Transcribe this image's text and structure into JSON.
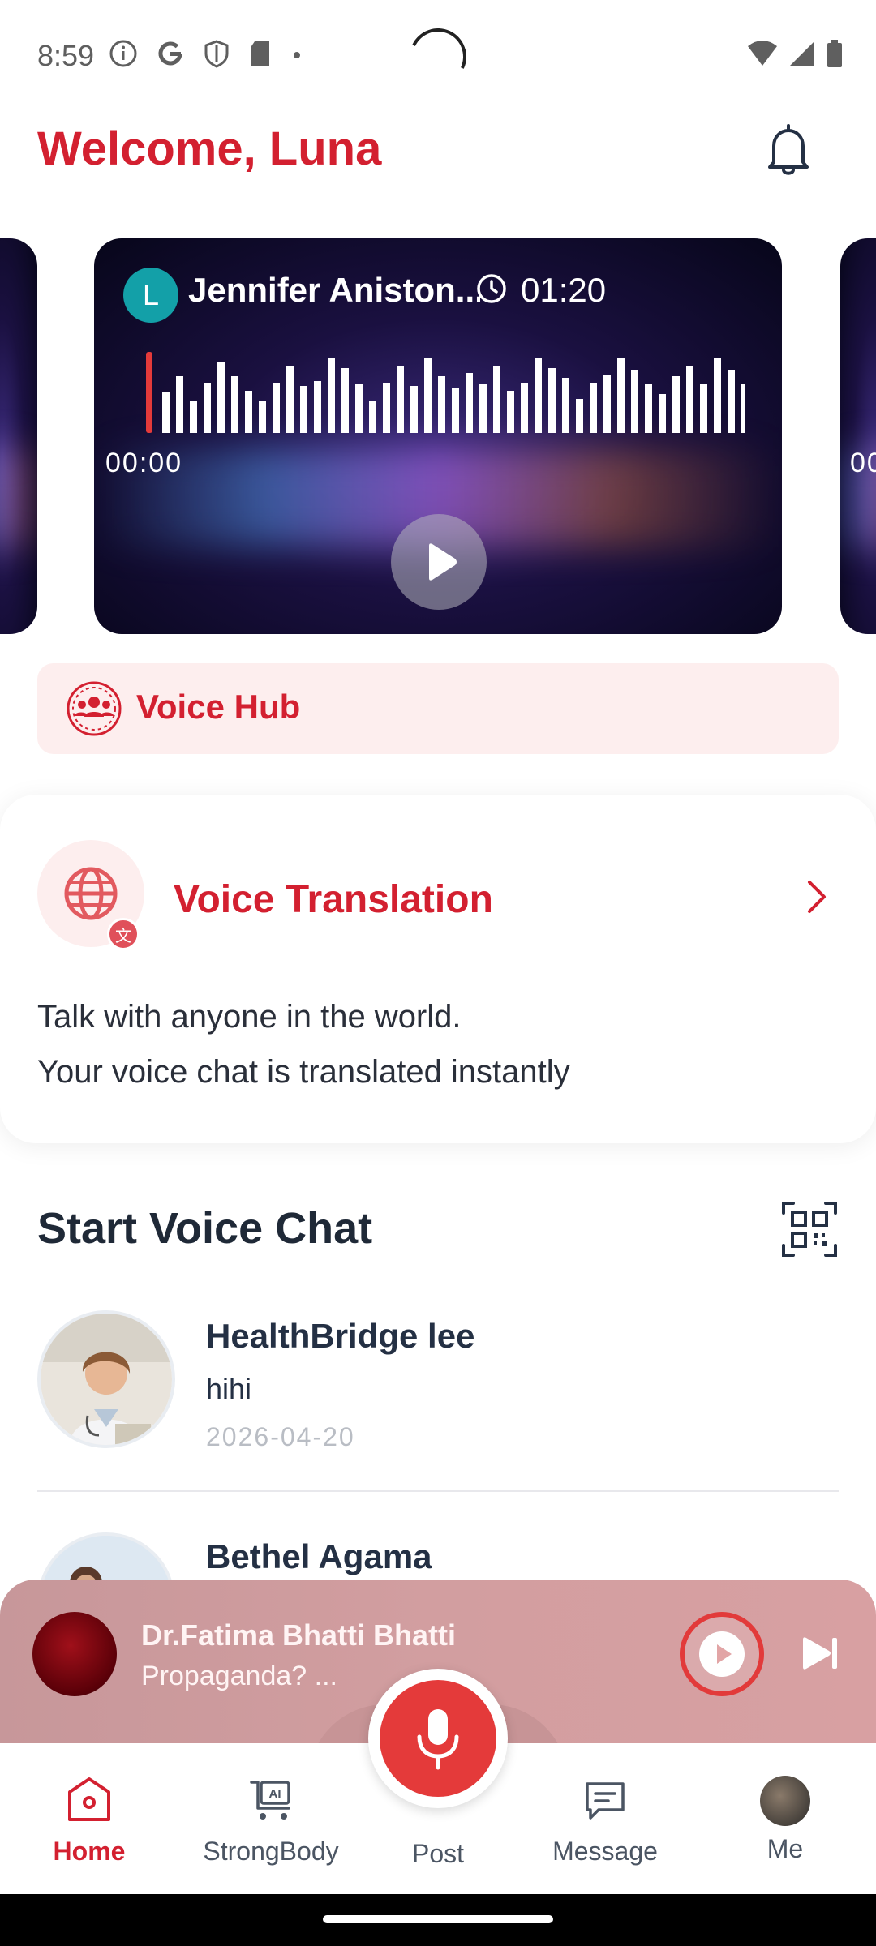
{
  "status_bar": {
    "time": "8:59"
  },
  "header": {
    "welcome": "Welcome, Luna"
  },
  "carousel": {
    "current": {
      "avatar_letter": "L",
      "name": "Jennifer Aniston...",
      "duration": "01:20",
      "elapsed": "00:00"
    },
    "next_elapsed_partial": "00"
  },
  "voice_hub": {
    "label": "Voice Hub"
  },
  "translation": {
    "title": "Voice Translation",
    "line1": "Talk with anyone in the world.",
    "line2": "Your voice chat is translated instantly"
  },
  "voice_chat": {
    "title": "Start Voice Chat",
    "items": [
      {
        "name": "HealthBridge lee",
        "message": "hihi",
        "date": "2026-04-20"
      },
      {
        "name": "Bethel Agama"
      }
    ]
  },
  "mini_player": {
    "title": "Dr.Fatima Bhatti Bhatti",
    "subtitle": "Propaganda? ..."
  },
  "nav": {
    "home": "Home",
    "strongbody": "StrongBody",
    "post": "Post",
    "message": "Message",
    "me": "Me"
  },
  "colors": {
    "accent": "#d32030",
    "mic": "#e43a3a",
    "hub_bg": "#fdeeee"
  }
}
